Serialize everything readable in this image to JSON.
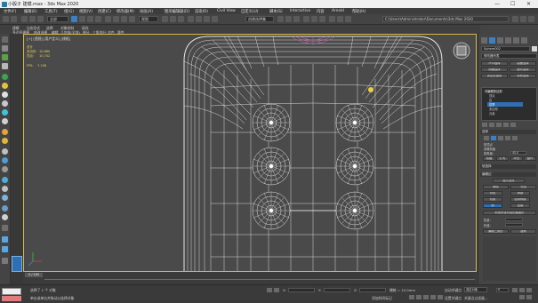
{
  "window": {
    "title": "小骰子 建模.max - 3ds Max 2020",
    "min": "—",
    "max": "☐",
    "close": "✕"
  },
  "menu": [
    "文件(F)",
    "编辑(E)",
    "工具(T)",
    "组(G)",
    "视图(V)",
    "创建(C)",
    "修改器(M)",
    "动画(A)",
    "图形编辑器(D)",
    "渲染(R)",
    "Civil View",
    "自定义(U)",
    "脚本(S)",
    "Interactive",
    "内容",
    "Arnold",
    "帮助(H)"
  ],
  "toolbar": {
    "selection_filter": "全部",
    "view_dropdown": "视图",
    "named_selection": "创建选择集",
    "path": "C:\\Users\\Administrator\\Documents\\3ds Max 2020"
  },
  "ribbon": {
    "tabs": [
      "建模",
      "自由形式",
      "选择",
      "对象绘制",
      "填充"
    ],
    "row2": [
      "多边形建模",
      "修改选择",
      "编辑",
      "几何体(全部)",
      "细分",
      "三角剖分",
      "对齐",
      "属性"
    ]
  },
  "viewport": {
    "label": "[+] [透视] [用户定义] [线框]",
    "stats": {
      "total_label": "总计",
      "polys_label": "多边形:",
      "polys": "10,680",
      "verts_label": "顶点:",
      "verts": "10,742",
      "fps_label": "FPS:",
      "fps": "7.158"
    }
  },
  "command_panel": {
    "object_name": "Sphere002",
    "modifier_list": "修改器列表",
    "buttons": [
      "FFD选择",
      "曲面选择",
      "网格选择",
      "面片选择",
      "多边形选择",
      "体积选择"
    ],
    "stack": [
      "可编辑多边形",
      "顶点",
      "边",
      "边界",
      "多边形",
      "元素"
    ],
    "stack_selected_index": 3,
    "rollout_selection": "选择",
    "by_vertex": "按顶点",
    "ignore_backface": "忽略背面",
    "by_angle": "按角度:",
    "angle_value": "45.0",
    "shrink": "收缩",
    "grow": "扩大",
    "ring": "环形",
    "loop": "循环",
    "rollout_soft": "软选择",
    "rollout_edit_edges": "编辑边",
    "insert_vertex": "插入顶点",
    "remove": "移除",
    "split": "分割",
    "extrude": "挤出",
    "weld": "焊接",
    "chamfer": "切角",
    "target_weld": "目标焊接",
    "bridge": "桥",
    "connect": "连接",
    "create_shape": "利用所选内容创建图形",
    "weight": "权重:",
    "crease": "折缝:",
    "edit_tri": "编辑三角形",
    "turn": "旋转"
  },
  "timeline": {
    "frame_display": "0 / 100"
  },
  "status": {
    "objects_selected": "选择了 1 个 对象",
    "prompt": "单击或单击并拖动以选择对象",
    "x_label": "X:",
    "y_label": "Y:",
    "z_label": "Z:",
    "grid": "栅格 = 10.0mm",
    "add_time_tag": "添加时间标记",
    "autokey": "自动关键点",
    "set_key": "设置关键点",
    "selected": "选定对象",
    "key_filters": "关键点过滤器...",
    "frame": "0",
    "script_label": "MAXScript 迷你侦听器"
  },
  "colors": {
    "viewport_bg": "#4a4a4a",
    "wire": "#e6e6e6",
    "active_border": "#d5b94a",
    "selection_blue": "#2f6fb3",
    "pink": "#c46ab3"
  }
}
